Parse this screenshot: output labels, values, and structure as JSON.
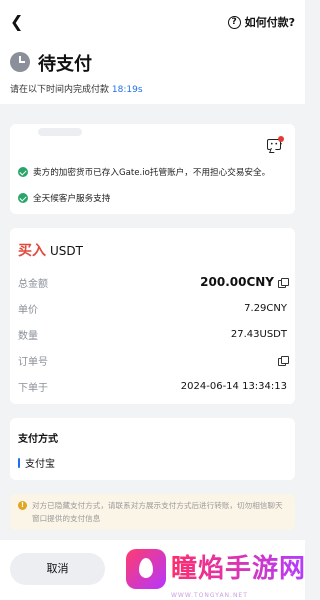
{
  "nav": {
    "back_icon": "chevron-left-icon",
    "help_label": "如何付款?"
  },
  "header": {
    "title": "待支付",
    "deadline_text": "请在以下时间内完成付款",
    "deadline_time": "18:19s"
  },
  "merchant": {
    "assurances": [
      "卖方的加密货币已存入Gate.io托管账户，不用担心交易安全。",
      "全天候客户服务支持"
    ]
  },
  "order": {
    "side": "买入",
    "asset": "USDT",
    "rows": [
      {
        "label": "总金额",
        "value": "200.00CNY"
      },
      {
        "label": "单价",
        "value": "7.29CNY"
      },
      {
        "label": "数量",
        "value": "27.43USDT"
      },
      {
        "label": "订单号",
        "value": ""
      },
      {
        "label": "下单于",
        "value": "2024-06-14 13:34:13"
      }
    ]
  },
  "payment": {
    "title": "支付方式",
    "method": "支付宝"
  },
  "notice": {
    "text": "对方已隐藏支付方式，请联系对方展示支付方式后进行转账，切勿相信聊天窗口提供的支付信息"
  },
  "bottom": {
    "cancel_label": "取消"
  },
  "watermark": {
    "text": "瞳焰手游网",
    "url": "WWW.TONGYAN.NET"
  },
  "colors": {
    "buy": "#e04a3f",
    "success": "#2aa56a",
    "accent": "#1f6feb",
    "warning": "#e0a623"
  }
}
